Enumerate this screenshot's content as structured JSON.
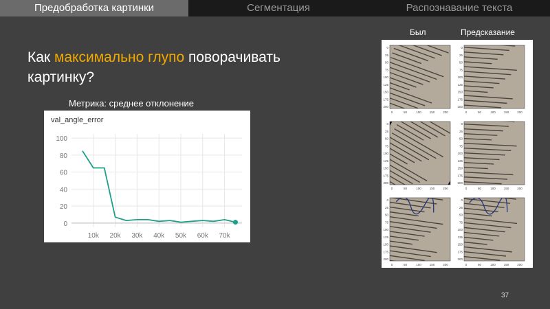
{
  "tabs": [
    {
      "label": "Предобработка картинки",
      "active": true
    },
    {
      "label": "Сегментация",
      "active": false
    },
    {
      "label": "Распознавание текста",
      "active": false
    }
  ],
  "slide": {
    "title_pre": "Как ",
    "title_highlight": "максимально глупо",
    "title_post": " поворачивать картинку?",
    "subtitle": "Метрика: среднее отклонение",
    "page_number": "37"
  },
  "columns": {
    "before": "Было",
    "predicted": "Предсказание"
  },
  "colors": {
    "accent": "#f2a900",
    "series": "#1f9e89",
    "tab_active": "#6b6b6b",
    "tab_inactive": "#1a1a1a"
  },
  "chart_data": {
    "type": "line",
    "title": "val_angle_error",
    "xlabel": "",
    "ylabel": "",
    "xlim": [
      0,
      78000
    ],
    "ylim": [
      -5,
      105
    ],
    "xticks": [
      10000,
      20000,
      30000,
      40000,
      50000,
      60000,
      70000
    ],
    "xtick_labels": [
      "10k",
      "20k",
      "30k",
      "40k",
      "50k",
      "60k",
      "70k"
    ],
    "yticks": [
      0,
      20,
      40,
      60,
      80,
      100
    ],
    "grid": true,
    "series": [
      {
        "x": [
          5000,
          10000,
          15000,
          20000,
          25000,
          30000,
          35000,
          40000,
          45000,
          50000,
          55000,
          60000,
          65000,
          70000,
          75000
        ],
        "y": [
          85,
          65,
          65,
          7,
          3,
          4,
          4,
          2,
          3,
          1,
          2,
          3,
          2,
          4,
          1
        ]
      }
    ]
  },
  "thumbnails": {
    "before_axis": {
      "yticks": [
        "0",
        "25",
        "50",
        "75",
        "100",
        "125",
        "150",
        "175",
        "200"
      ],
      "xticks": [
        "0",
        "50",
        "100",
        "150",
        "200"
      ]
    },
    "predicted_axis": {
      "yticks": [
        "0",
        "25",
        "50",
        "75",
        "100",
        "125",
        "150",
        "175",
        "200"
      ],
      "xticks": [
        "0",
        "50",
        "100",
        "150",
        "200"
      ]
    },
    "rows": [
      {
        "before_angle": 20,
        "predicted_angle": 4
      },
      {
        "before_angle": 30,
        "predicted_angle": 3
      },
      {
        "before_angle": 8,
        "predicted_angle": 6
      }
    ]
  }
}
